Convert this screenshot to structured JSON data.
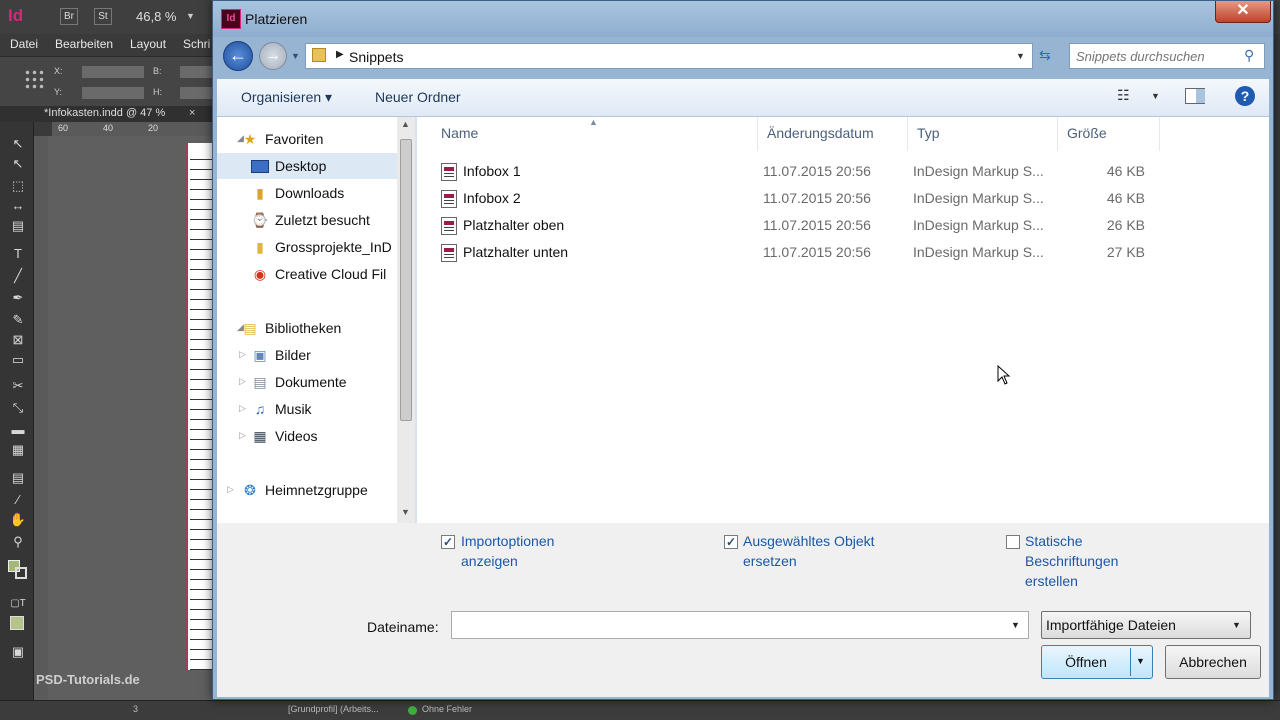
{
  "app": {
    "logo": "Id",
    "bridge_btn": "Br",
    "stock_btn": "St",
    "zoom": "46,8 %",
    "menu": [
      "Datei",
      "Bearbeiten",
      "Layout",
      "Schri"
    ],
    "control": {
      "x": "X:",
      "y": "Y:",
      "w": "B:",
      "h": "H:"
    },
    "doc_tab": "*Infokasten.indd @ 47 %",
    "doc_tab_close": "×",
    "ruler": [
      "60",
      "40",
      "20"
    ],
    "status_page": "3",
    "status_profile": "[Grundprofil] (Arbeits...",
    "status_errors": "Ohne Fehler",
    "watermark": "PSD-Tutorials.de"
  },
  "dialog": {
    "title": "Platzieren",
    "icon": "Id",
    "close": "✕",
    "breadcrumb": "Snippets",
    "search_placeholder": "Snippets durchsuchen",
    "toolbar": {
      "organize": "Organisieren ▾",
      "new_folder": "Neuer Ordner"
    },
    "nav": {
      "favorites_header": "Favoriten",
      "favorites": [
        {
          "label": "Desktop",
          "icon": "desktop-icon"
        },
        {
          "label": "Downloads",
          "icon": "downloads-icon"
        },
        {
          "label": "Zuletzt besucht",
          "icon": "recent-icon"
        },
        {
          "label": "Grossprojekte_InD",
          "icon": "folder-icon"
        },
        {
          "label": "Creative Cloud Fil",
          "icon": "creative-cloud-icon"
        }
      ],
      "libraries_header": "Bibliotheken",
      "libraries": [
        {
          "label": "Bilder",
          "icon": "pictures-icon"
        },
        {
          "label": "Dokumente",
          "icon": "documents-icon"
        },
        {
          "label": "Musik",
          "icon": "music-icon"
        },
        {
          "label": "Videos",
          "icon": "videos-icon"
        }
      ],
      "homegroup": "Heimnetzgruppe"
    },
    "columns": {
      "name": "Name",
      "date": "Änderungsdatum",
      "type": "Typ",
      "size": "Größe"
    },
    "files": [
      {
        "name": "Infobox 1",
        "date": "11.07.2015 20:56",
        "type": "InDesign Markup S...",
        "size": "46 KB"
      },
      {
        "name": "Infobox 2",
        "date": "11.07.2015 20:56",
        "type": "InDesign Markup S...",
        "size": "46 KB"
      },
      {
        "name": "Platzhalter oben",
        "date": "11.07.2015 20:56",
        "type": "InDesign Markup S...",
        "size": "26 KB"
      },
      {
        "name": "Platzhalter unten",
        "date": "11.07.2015 20:56",
        "type": "InDesign Markup S...",
        "size": "27 KB"
      }
    ],
    "options": {
      "import_options": {
        "line1": "Importoptionen",
        "line2": "anzeigen",
        "checked": true
      },
      "replace_selected": {
        "line1": "Ausgewähltes Objekt",
        "line2": "ersetzen",
        "checked": true
      },
      "static_captions": {
        "line1": "Statische",
        "line2": "Beschriftungen",
        "line3": "erstellen",
        "checked": false
      }
    },
    "filename_label": "Dateiname:",
    "filename_value": "",
    "filetype": "Importfähige Dateien",
    "open_button": "Öffnen",
    "cancel_button": "Abbrechen"
  }
}
